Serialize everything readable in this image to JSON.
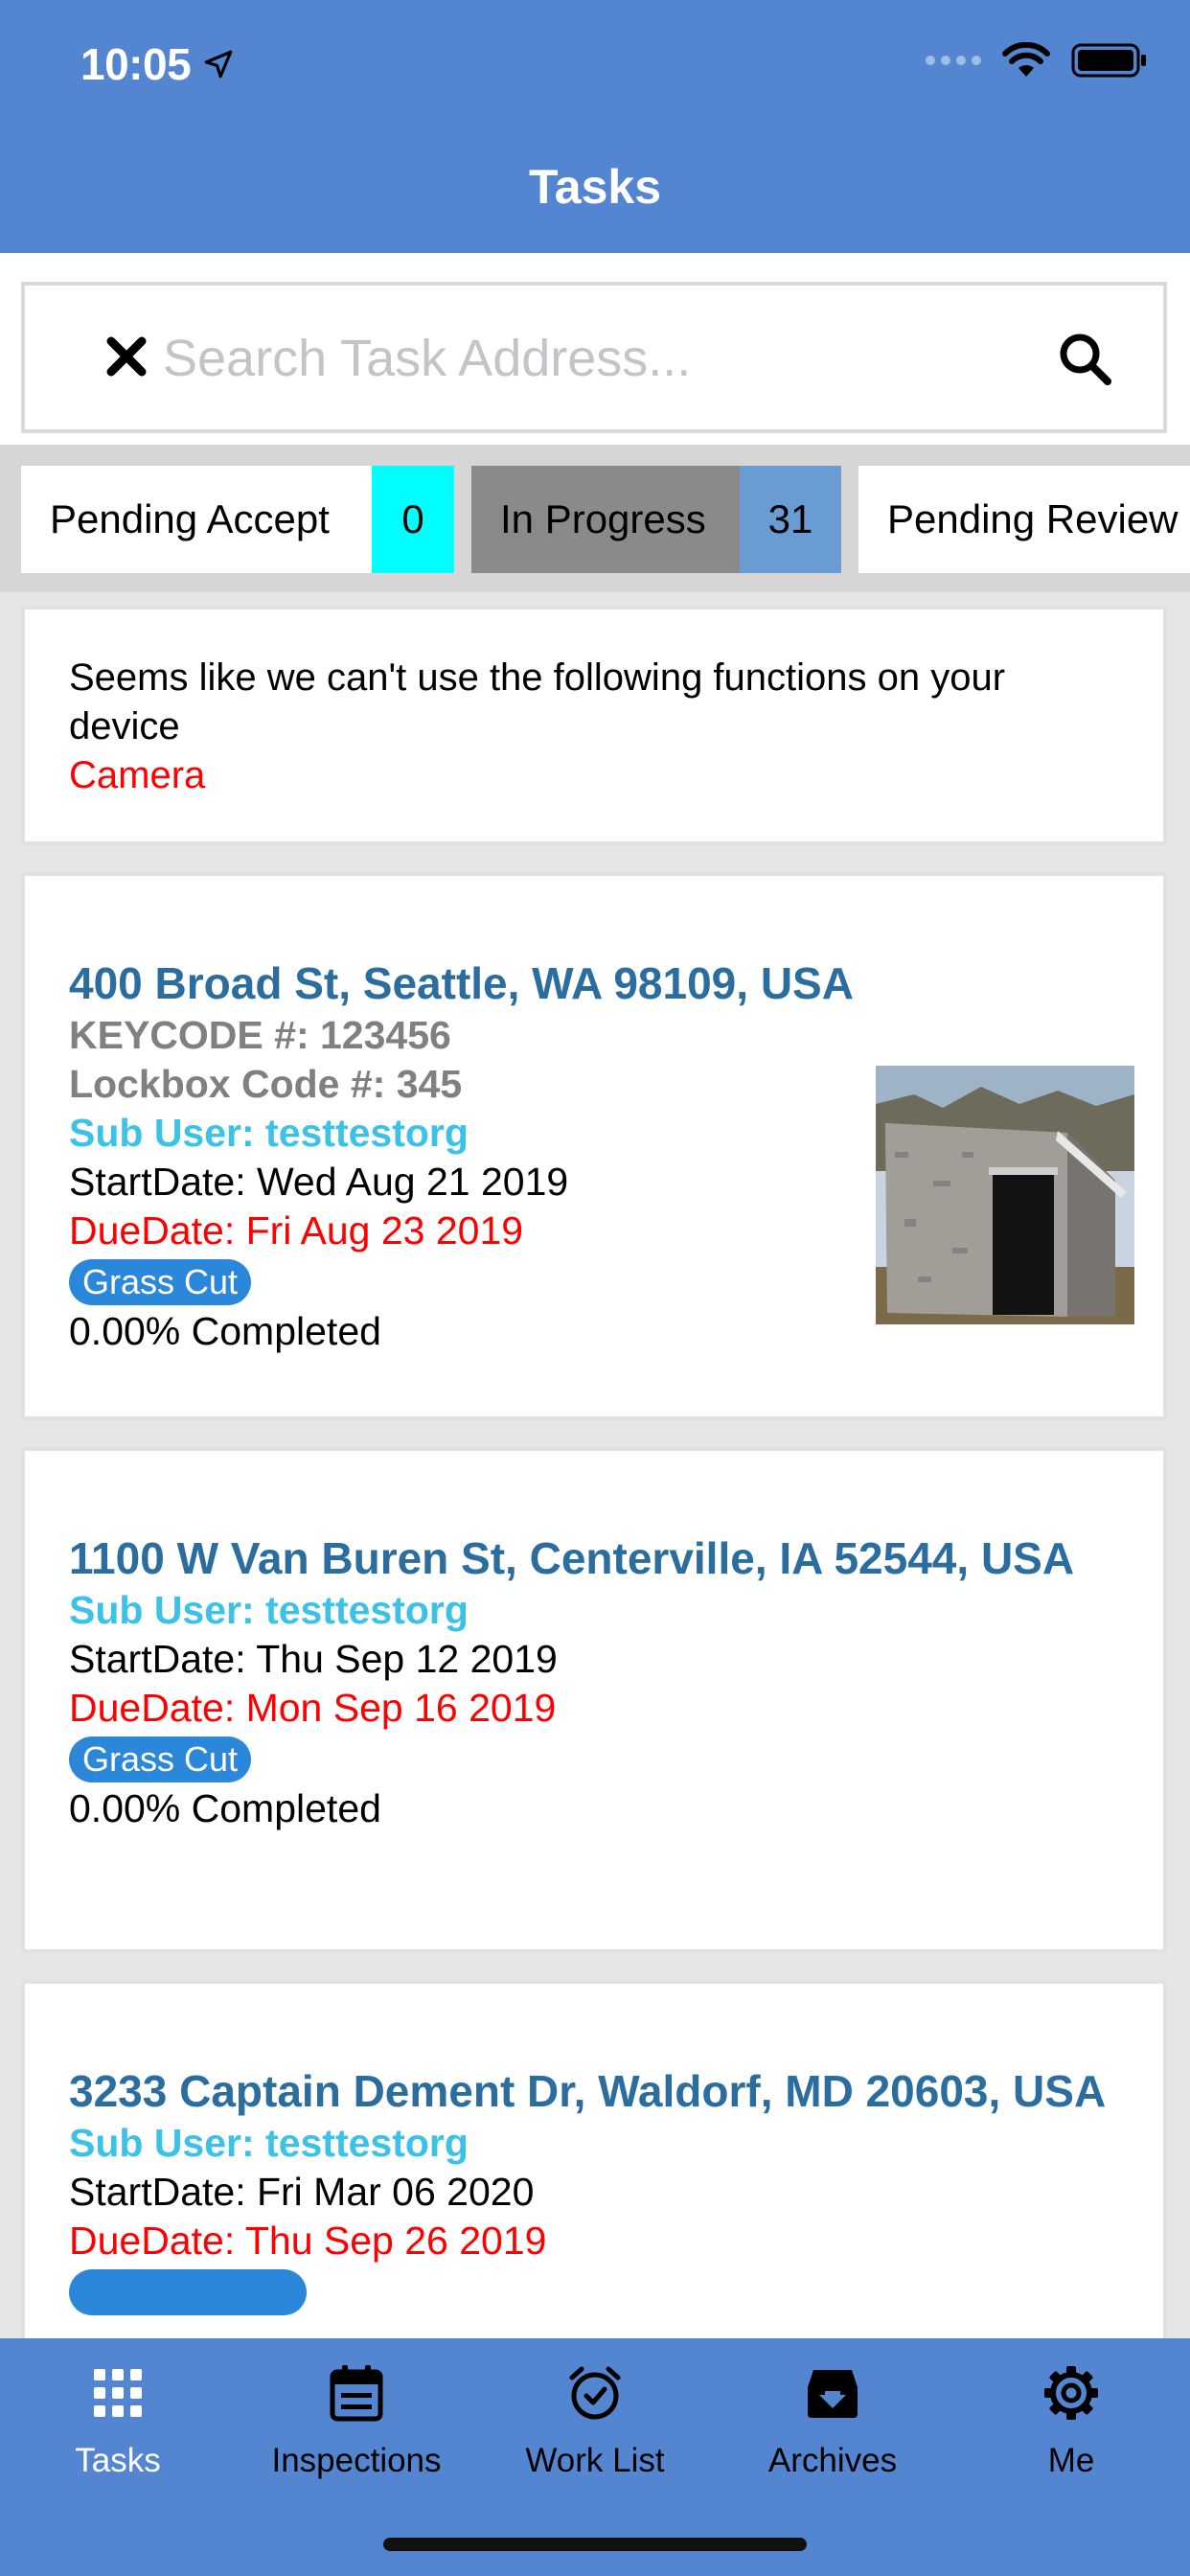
{
  "status_bar": {
    "time": "10:05"
  },
  "header": {
    "title": "Tasks"
  },
  "search": {
    "placeholder": "Search Task Address...",
    "value": ""
  },
  "filters": [
    {
      "label": "Pending Accept",
      "count": "0",
      "count_color": "#00ffff"
    },
    {
      "label": "In Progress",
      "count": "31",
      "count_color": "#6a9bd3",
      "selected": true
    },
    {
      "label": "Pending Review"
    }
  ],
  "notice": {
    "message": "Seems like we can't use the following functions on your device",
    "function": "Camera"
  },
  "tasks": [
    {
      "address": "400 Broad St, Seattle, WA 98109, USA",
      "keycode": "KEYCODE #: 123456",
      "lockbox": "Lockbox Code #: 345",
      "sub_user": "Sub User: testtestorg",
      "start_date": "StartDate: Wed Aug 21 2019",
      "due_date": "DueDate: Fri Aug 23 2019",
      "tag": "Grass Cut",
      "progress": "0.00% Completed"
    },
    {
      "address": "1100 W Van Buren St, Centerville, IA 52544, USA",
      "sub_user": "Sub User: testtestorg",
      "start_date": "StartDate: Thu Sep 12 2019",
      "due_date": "DueDate: Mon Sep 16 2019",
      "tag": "Grass Cut",
      "progress": "0.00% Completed"
    },
    {
      "address": "3233 Captain Dement Dr, Waldorf, MD 20603, USA",
      "sub_user": "Sub User: testtestorg",
      "start_date": "StartDate: Fri Mar 06 2020",
      "due_date": "DueDate: Thu Sep 26 2019"
    }
  ],
  "nav": [
    {
      "label": "Tasks",
      "icon": "grid-icon",
      "active": true
    },
    {
      "label": "Inspections",
      "icon": "calendar-icon"
    },
    {
      "label": "Work List",
      "icon": "alarm-clock-icon"
    },
    {
      "label": "Archives",
      "icon": "archive-box-icon"
    },
    {
      "label": "Me",
      "icon": "gear-icon"
    }
  ],
  "colors": {
    "header": "#5485d0",
    "address": "#2a6d9e",
    "sub_user": "#3cc1e7",
    "due_date": "#ff0000",
    "tag": "#2b87d9"
  }
}
